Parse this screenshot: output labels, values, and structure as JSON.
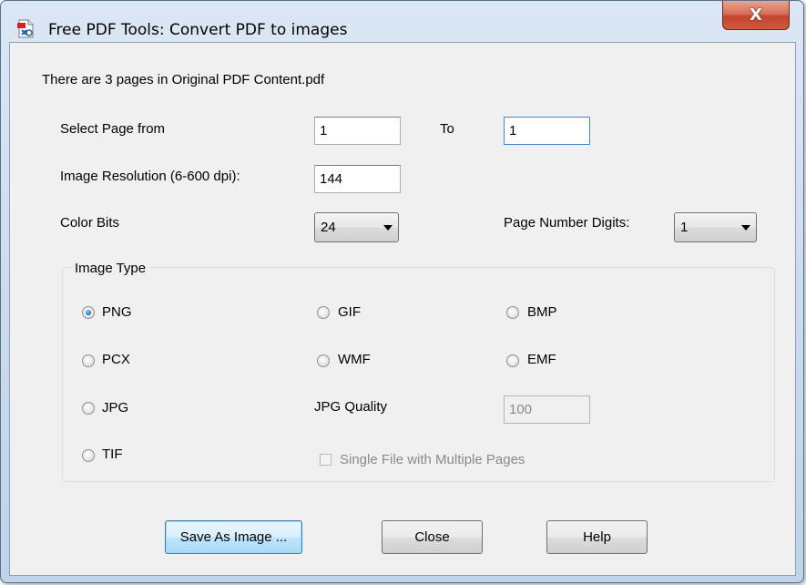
{
  "window": {
    "title": "Free PDF Tools: Convert PDF to images",
    "close_glyph": "X",
    "icon": "pdf-document-icon"
  },
  "info_text": "There are 3 pages in Original PDF Content.pdf",
  "page_range": {
    "from_label": "Select Page from",
    "from_value": "1",
    "to_label": "To",
    "to_value": "1"
  },
  "resolution": {
    "label": "Image Resolution (6-600 dpi):",
    "value": "144"
  },
  "color_bits": {
    "label": "Color Bits",
    "value": "24"
  },
  "page_digits": {
    "label": "Page Number Digits:",
    "value": "1"
  },
  "image_type": {
    "group_label": "Image Type",
    "selected": "PNG",
    "options": {
      "png": "PNG",
      "gif": "GIF",
      "bmp": "BMP",
      "pcx": "PCX",
      "wmf": "WMF",
      "emf": "EMF",
      "jpg": "JPG",
      "tif": "TIF"
    },
    "jpg_quality_label": "JPG Quality",
    "jpg_quality_value": "100",
    "single_file_label": "Single File with Multiple Pages"
  },
  "buttons": {
    "save": "Save As Image ...",
    "close": "Close",
    "help": "Help"
  },
  "colors": {
    "window_frame": "#c9daee",
    "close_button": "#c2452e",
    "radio_selected": "#2b7cd4",
    "default_button_border": "#3c7fb1"
  }
}
